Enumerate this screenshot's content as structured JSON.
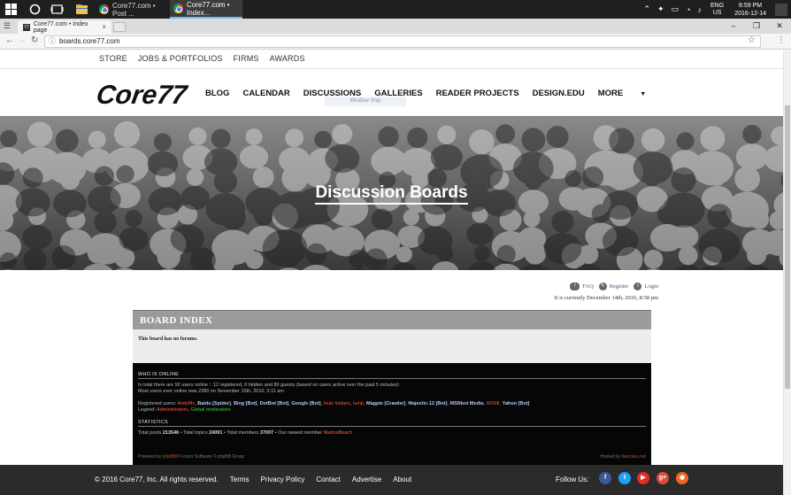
{
  "taskbar": {
    "tasks": [
      {
        "label": "Core77.com • Post ..."
      },
      {
        "label": "Core77.com • Index..."
      }
    ],
    "tray": {
      "lang_top": "ENG",
      "lang_bottom": "US",
      "time": "8:59 PM",
      "date": "2016-12-14"
    }
  },
  "browser": {
    "tab_title": "Core77.com • Index page",
    "tab_favicon": "77",
    "url": "boards.core77.com",
    "window_controls": {
      "minimize": "–",
      "maximize": "❐",
      "close": "✕"
    }
  },
  "site": {
    "topnav": [
      "STORE",
      "JOBS & PORTFOLIOS",
      "FIRMS",
      "AWARDS"
    ],
    "logo_text": "Core77",
    "mainnav": [
      "BLOG",
      "CALENDAR",
      "DISCUSSIONS",
      "GALLERIES",
      "READER PROJECTS",
      "DESIGN.EDU",
      "MORE"
    ],
    "tooltip": "Window Snip",
    "hero_title": "Discussion Boards"
  },
  "forum": {
    "util_links": {
      "faq": "FAQ",
      "register": "Register",
      "login": "Login"
    },
    "current_time": "It is currently December 14th, 2016, 8:58 pm",
    "board_title": "BOARD INDEX",
    "no_forums": "This board has no forums.",
    "who_online_title": "WHO IS ONLINE",
    "online_lines": [
      "In total there are 92 users online :: 12 registered, 0 hidden and 80 guests (based on users active over the past 5 minutes)",
      "Most users ever online was 2380 on November 15th, 2010, 5:11 am"
    ],
    "registered_label": "Registered users:",
    "registered_users": [
      {
        "name": "AndyMc",
        "kind": "red"
      },
      {
        "name": "Baidu [Spider]",
        "kind": "bot"
      },
      {
        "name": "Bing [Bot]",
        "kind": "bot"
      },
      {
        "name": "DotBot [Bot]",
        "kind": "bot"
      },
      {
        "name": "Google [Bot]",
        "kind": "bot"
      },
      {
        "name": "louis leblanc",
        "kind": "red"
      },
      {
        "name": "lump",
        "kind": "red"
      },
      {
        "name": "Magpie [Crawler]",
        "kind": "bot"
      },
      {
        "name": "Majestic-12 [Bot]",
        "kind": "bot"
      },
      {
        "name": "MSNbot Media",
        "kind": "bot"
      },
      {
        "name": "WSMI",
        "kind": "red"
      },
      {
        "name": "Yahoo [Bot]",
        "kind": "bot"
      }
    ],
    "legend_label": "Legend:",
    "legend_admin": "Administrators",
    "legend_mod": "Global moderators",
    "statistics_title": "STATISTICS",
    "stats": {
      "posts_label": "Total posts",
      "posts": "213546",
      "topics_label": "Total topics",
      "topics": "24091",
      "members_label": "Total members",
      "members": "37007",
      "newest_label": "Our newest member",
      "newest": "MarinaBeach"
    },
    "powered_pre": "Powered by",
    "powered_link": "phpBB®",
    "powered_post": "Forum Software © phpBB Group",
    "hosted_pre": "Hosted by",
    "hosted_link": "Nexcess.net"
  },
  "footer": {
    "copyright": "© 2016 Core77, Inc. All rights reserved.",
    "links": [
      "Terms",
      "Privacy Policy",
      "Contact",
      "Advertise",
      "About"
    ],
    "follow": "Follow Us:",
    "social": [
      {
        "icon": "facebook-icon",
        "glyph": "f",
        "color": "#3b5998"
      },
      {
        "icon": "twitter-icon",
        "glyph": "t",
        "color": "#1da1f2"
      },
      {
        "icon": "youtube-icon",
        "glyph": "▶",
        "color": "#e52d27"
      },
      {
        "icon": "google-plus-icon",
        "glyph": "g+",
        "color": "#dd4b39"
      },
      {
        "icon": "rss-icon",
        "glyph": "◉",
        "color": "#f26522"
      }
    ]
  }
}
